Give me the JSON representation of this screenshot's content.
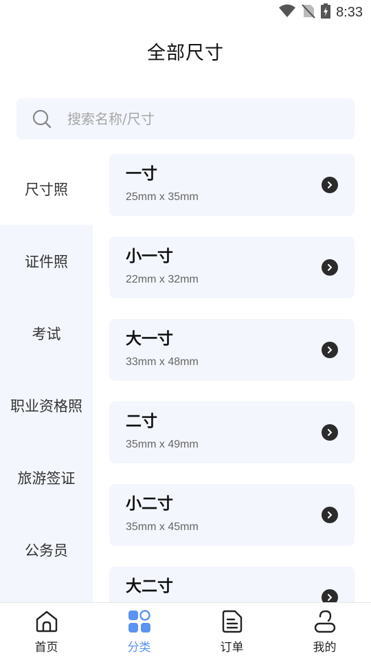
{
  "status_bar": {
    "time": "8:33"
  },
  "header": {
    "title": "全部尺寸"
  },
  "search": {
    "placeholder": "搜索名称/尺寸"
  },
  "sidebar": {
    "items": [
      {
        "label": "尺寸照",
        "active": true
      },
      {
        "label": "证件照",
        "active": false
      },
      {
        "label": "考试",
        "active": false
      },
      {
        "label": "职业资格照",
        "active": false
      },
      {
        "label": "旅游签证",
        "active": false
      },
      {
        "label": "公务员",
        "active": false
      }
    ]
  },
  "sizes": [
    {
      "name": "一寸",
      "dims": "25mm x 35mm"
    },
    {
      "name": "小一寸",
      "dims": "22mm x 32mm"
    },
    {
      "name": "大一寸",
      "dims": "33mm x 48mm"
    },
    {
      "name": "二寸",
      "dims": "35mm x 49mm"
    },
    {
      "name": "小二寸",
      "dims": "35mm x 45mm"
    },
    {
      "name": "大二寸",
      "dims": ""
    }
  ],
  "tabbar": {
    "tabs": [
      {
        "label": "首页",
        "icon": "home-icon"
      },
      {
        "label": "分类",
        "icon": "category-icon",
        "active": true
      },
      {
        "label": "订单",
        "icon": "order-icon"
      },
      {
        "label": "我的",
        "icon": "profile-icon"
      }
    ]
  },
  "colors": {
    "accent": "#5a93f0",
    "panel": "#f3f6fc",
    "arrow": "#2b2b2b"
  }
}
